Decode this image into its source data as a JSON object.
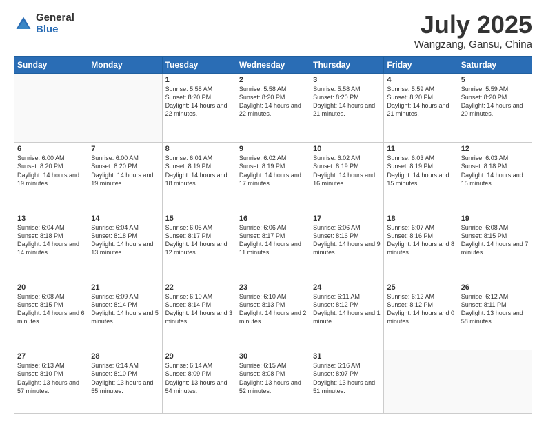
{
  "header": {
    "logo_general": "General",
    "logo_blue": "Blue",
    "month_title": "July 2025",
    "location": "Wangzang, Gansu, China"
  },
  "weekdays": [
    "Sunday",
    "Monday",
    "Tuesday",
    "Wednesday",
    "Thursday",
    "Friday",
    "Saturday"
  ],
  "weeks": [
    [
      {
        "day": "",
        "text": ""
      },
      {
        "day": "",
        "text": ""
      },
      {
        "day": "1",
        "text": "Sunrise: 5:58 AM\nSunset: 8:20 PM\nDaylight: 14 hours and 22 minutes."
      },
      {
        "day": "2",
        "text": "Sunrise: 5:58 AM\nSunset: 8:20 PM\nDaylight: 14 hours and 22 minutes."
      },
      {
        "day": "3",
        "text": "Sunrise: 5:58 AM\nSunset: 8:20 PM\nDaylight: 14 hours and 21 minutes."
      },
      {
        "day": "4",
        "text": "Sunrise: 5:59 AM\nSunset: 8:20 PM\nDaylight: 14 hours and 21 minutes."
      },
      {
        "day": "5",
        "text": "Sunrise: 5:59 AM\nSunset: 8:20 PM\nDaylight: 14 hours and 20 minutes."
      }
    ],
    [
      {
        "day": "6",
        "text": "Sunrise: 6:00 AM\nSunset: 8:20 PM\nDaylight: 14 hours and 19 minutes."
      },
      {
        "day": "7",
        "text": "Sunrise: 6:00 AM\nSunset: 8:20 PM\nDaylight: 14 hours and 19 minutes."
      },
      {
        "day": "8",
        "text": "Sunrise: 6:01 AM\nSunset: 8:19 PM\nDaylight: 14 hours and 18 minutes."
      },
      {
        "day": "9",
        "text": "Sunrise: 6:02 AM\nSunset: 8:19 PM\nDaylight: 14 hours and 17 minutes."
      },
      {
        "day": "10",
        "text": "Sunrise: 6:02 AM\nSunset: 8:19 PM\nDaylight: 14 hours and 16 minutes."
      },
      {
        "day": "11",
        "text": "Sunrise: 6:03 AM\nSunset: 8:19 PM\nDaylight: 14 hours and 15 minutes."
      },
      {
        "day": "12",
        "text": "Sunrise: 6:03 AM\nSunset: 8:18 PM\nDaylight: 14 hours and 15 minutes."
      }
    ],
    [
      {
        "day": "13",
        "text": "Sunrise: 6:04 AM\nSunset: 8:18 PM\nDaylight: 14 hours and 14 minutes."
      },
      {
        "day": "14",
        "text": "Sunrise: 6:04 AM\nSunset: 8:18 PM\nDaylight: 14 hours and 13 minutes."
      },
      {
        "day": "15",
        "text": "Sunrise: 6:05 AM\nSunset: 8:17 PM\nDaylight: 14 hours and 12 minutes."
      },
      {
        "day": "16",
        "text": "Sunrise: 6:06 AM\nSunset: 8:17 PM\nDaylight: 14 hours and 11 minutes."
      },
      {
        "day": "17",
        "text": "Sunrise: 6:06 AM\nSunset: 8:16 PM\nDaylight: 14 hours and 9 minutes."
      },
      {
        "day": "18",
        "text": "Sunrise: 6:07 AM\nSunset: 8:16 PM\nDaylight: 14 hours and 8 minutes."
      },
      {
        "day": "19",
        "text": "Sunrise: 6:08 AM\nSunset: 8:15 PM\nDaylight: 14 hours and 7 minutes."
      }
    ],
    [
      {
        "day": "20",
        "text": "Sunrise: 6:08 AM\nSunset: 8:15 PM\nDaylight: 14 hours and 6 minutes."
      },
      {
        "day": "21",
        "text": "Sunrise: 6:09 AM\nSunset: 8:14 PM\nDaylight: 14 hours and 5 minutes."
      },
      {
        "day": "22",
        "text": "Sunrise: 6:10 AM\nSunset: 8:14 PM\nDaylight: 14 hours and 3 minutes."
      },
      {
        "day": "23",
        "text": "Sunrise: 6:10 AM\nSunset: 8:13 PM\nDaylight: 14 hours and 2 minutes."
      },
      {
        "day": "24",
        "text": "Sunrise: 6:11 AM\nSunset: 8:12 PM\nDaylight: 14 hours and 1 minute."
      },
      {
        "day": "25",
        "text": "Sunrise: 6:12 AM\nSunset: 8:12 PM\nDaylight: 14 hours and 0 minutes."
      },
      {
        "day": "26",
        "text": "Sunrise: 6:12 AM\nSunset: 8:11 PM\nDaylight: 13 hours and 58 minutes."
      }
    ],
    [
      {
        "day": "27",
        "text": "Sunrise: 6:13 AM\nSunset: 8:10 PM\nDaylight: 13 hours and 57 minutes."
      },
      {
        "day": "28",
        "text": "Sunrise: 6:14 AM\nSunset: 8:10 PM\nDaylight: 13 hours and 55 minutes."
      },
      {
        "day": "29",
        "text": "Sunrise: 6:14 AM\nSunset: 8:09 PM\nDaylight: 13 hours and 54 minutes."
      },
      {
        "day": "30",
        "text": "Sunrise: 6:15 AM\nSunset: 8:08 PM\nDaylight: 13 hours and 52 minutes."
      },
      {
        "day": "31",
        "text": "Sunrise: 6:16 AM\nSunset: 8:07 PM\nDaylight: 13 hours and 51 minutes."
      },
      {
        "day": "",
        "text": ""
      },
      {
        "day": "",
        "text": ""
      }
    ]
  ]
}
